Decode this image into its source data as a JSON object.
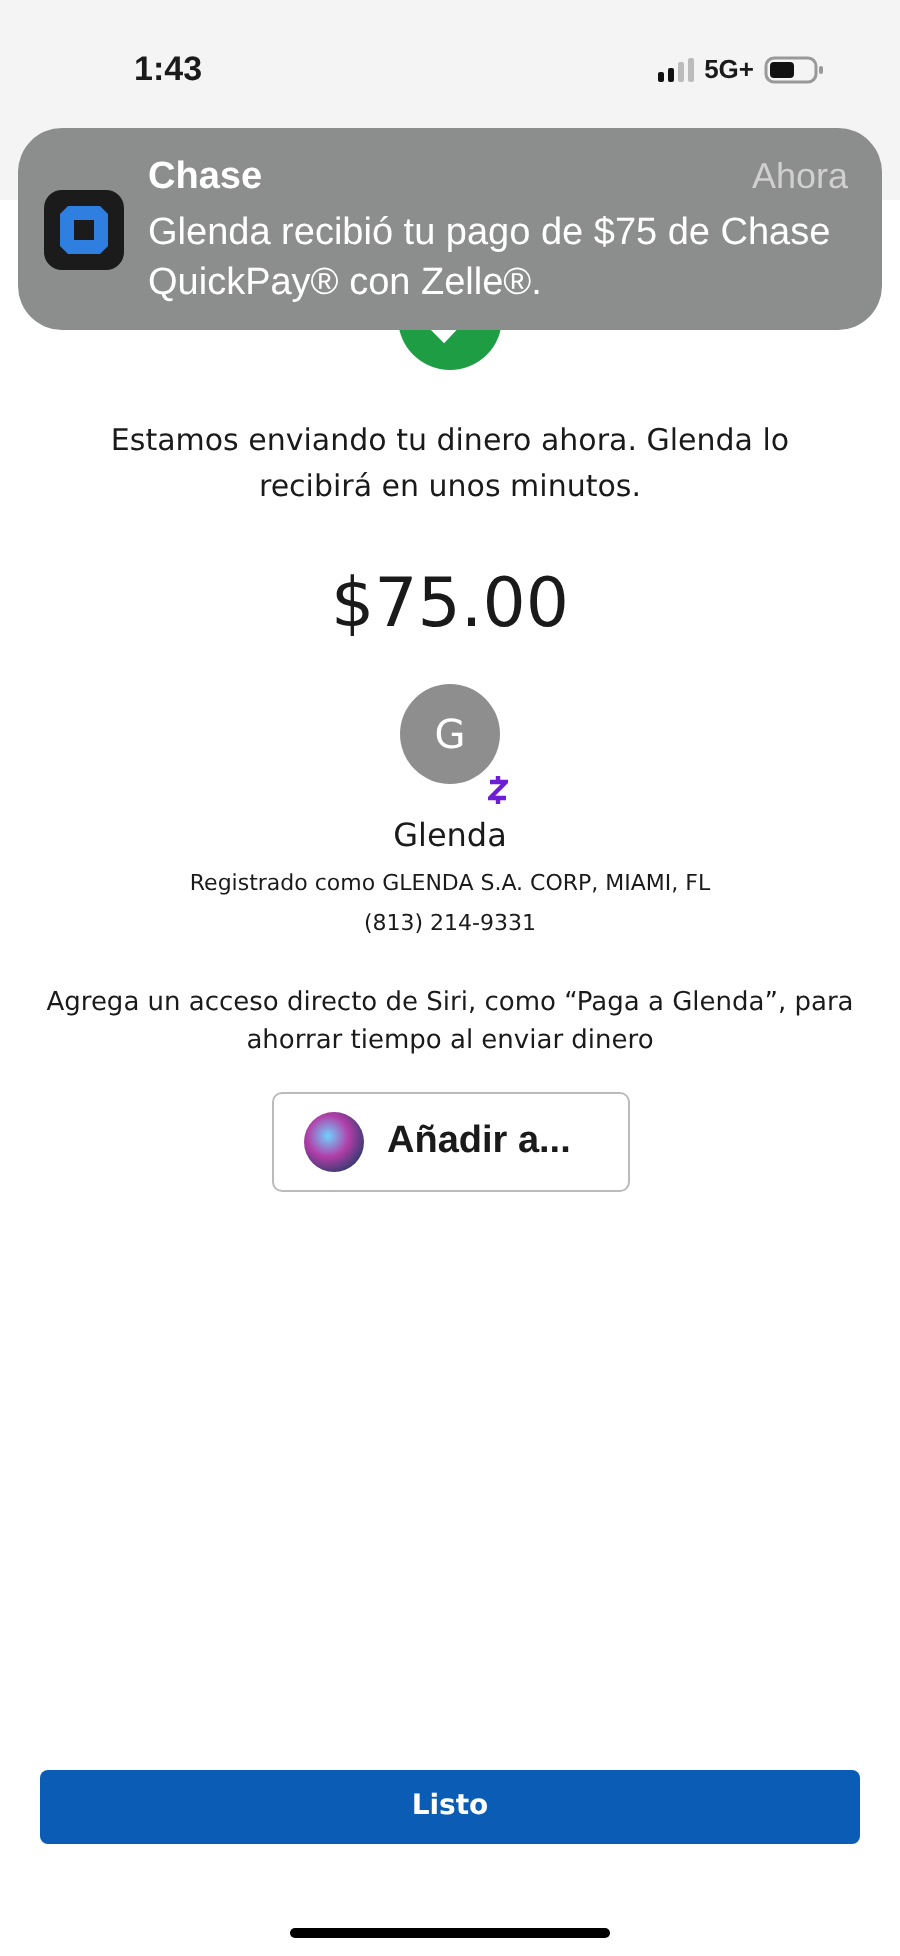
{
  "status_bar": {
    "time": "1:43",
    "network": "5G+"
  },
  "notification": {
    "app": "Chase",
    "time": "Ahora",
    "message": "Glenda recibió tu pago de $75 de Chase QuickPay® con Zelle®."
  },
  "message": "Estamos enviando tu dinero ahora. Glenda lo recibirá en unos minutos.",
  "amount": "$75.00",
  "recipient": {
    "initial": "G",
    "name": "Glenda",
    "registered": "Registrado como GLENDA S.A. CORP, MIAMI, FL",
    "phone": "(813) 214-9331"
  },
  "siri_prompt": "Agrega un acceso directo de Siri, como “Paga a Glenda”, para ahorrar tiempo al enviar dinero",
  "siri_button": "Añadir a...",
  "done_button": "Listo"
}
